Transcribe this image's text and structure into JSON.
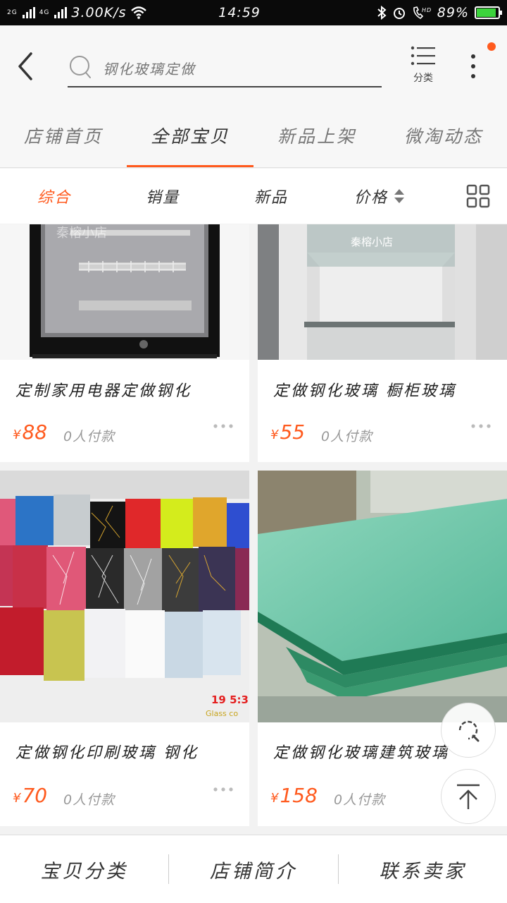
{
  "status_bar": {
    "network_top": "2G",
    "network_bottom": "4G",
    "speed": "3.00K/s",
    "time": "14:59",
    "battery_percent": "89%",
    "battery_level": 0.89
  },
  "header": {
    "search_text": "钢化玻璃定做",
    "category_label": "分类",
    "accent_color": "#ff5a1e"
  },
  "tabs": [
    {
      "label": "店铺首页"
    },
    {
      "label": "全部宝贝"
    },
    {
      "label": "新品上架"
    },
    {
      "label": "微淘动态"
    }
  ],
  "sort": [
    {
      "label": "综合"
    },
    {
      "label": "销量"
    },
    {
      "label": "新品"
    },
    {
      "label": "价格"
    }
  ],
  "products": [
    {
      "title": "定制家用电器定做钢化",
      "currency": "¥",
      "price": "88",
      "paid": "0人付款",
      "watermark": "秦榕小店",
      "image": "fridge"
    },
    {
      "title": "定做钢化玻璃 橱柜玻璃",
      "currency": "¥",
      "price": "55",
      "paid": "0人付款",
      "watermark": "秦榕小店",
      "image": "cabinet"
    },
    {
      "title": "定做钢化印刷玻璃 钢化",
      "currency": "¥",
      "price": "70",
      "paid": "0人付款",
      "overlay_number": "19  5:3",
      "overlay_small": "Glass co",
      "image": "tiles"
    },
    {
      "title": "定做钢化玻璃建筑玻璃",
      "currency": "¥",
      "price": "158",
      "paid": "0人付款",
      "image": "green-glass"
    }
  ],
  "bottom_nav": [
    {
      "label": "宝贝分类"
    },
    {
      "label": "店铺简介"
    },
    {
      "label": "联系卖家"
    }
  ]
}
